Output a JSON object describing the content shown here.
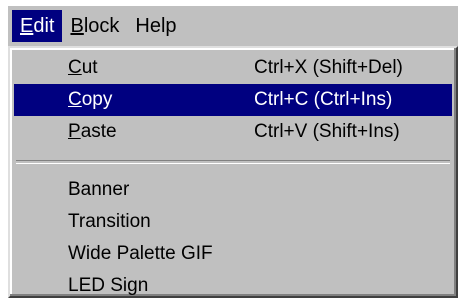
{
  "menubar": {
    "items": [
      {
        "mnemonic": "E",
        "rest": "dit"
      },
      {
        "mnemonic": "B",
        "rest": "lock"
      },
      {
        "mnemonic": "",
        "rest": "Help"
      }
    ]
  },
  "edit_menu": {
    "clipboard_items": [
      {
        "mnemonic": "C",
        "rest": "ut",
        "shortcut": "Ctrl+X (Shift+Del)"
      },
      {
        "mnemonic": "C",
        "rest": "opy",
        "shortcut": "Ctrl+C (Ctrl+Ins)"
      },
      {
        "mnemonic": "P",
        "rest": "aste",
        "shortcut": "Ctrl+V (Shift+Ins)"
      }
    ],
    "insert_items": [
      {
        "label": "Banner"
      },
      {
        "label": "Transition"
      },
      {
        "label": "Wide Palette GIF"
      },
      {
        "label": "LED Sign"
      }
    ]
  },
  "colors": {
    "menu_face": "#c0c0c0",
    "highlight": "#000080",
    "highlight_text": "#ffffff"
  }
}
